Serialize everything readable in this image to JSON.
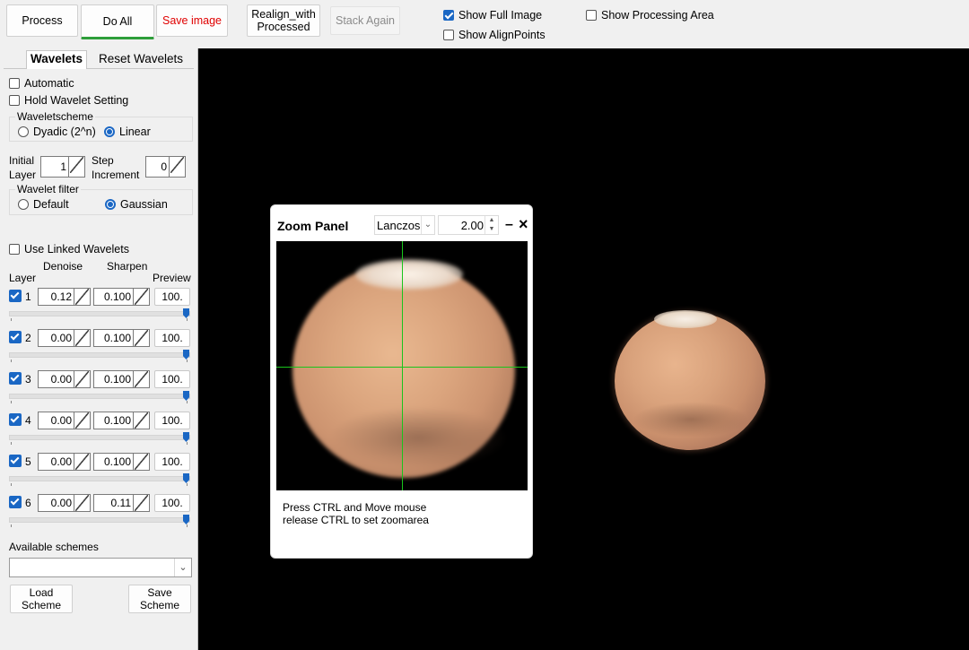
{
  "toolbar": {
    "process": "Process",
    "do_all": "Do All",
    "save_image": "Save image",
    "realign_line1": "Realign_with",
    "realign_line2": "Processed",
    "stack_again": "Stack Again",
    "show_full_image": "Show Full Image",
    "show_processing_area": "Show Processing Area",
    "show_alignpoints": "Show AlignPoints",
    "show_full_image_checked": true,
    "show_processing_area_checked": false,
    "show_alignpoints_checked": false
  },
  "sidebar": {
    "tab_wavelets": "Wavelets",
    "tab_reset": "Reset Wavelets",
    "automatic": "Automatic",
    "hold_setting": "Hold Wavelet Setting",
    "scheme_group": "Waveletscheme",
    "dyadic": "Dyadic (2^n)",
    "linear": "Linear",
    "initial_layer_l1": "Initial",
    "initial_layer_l2": "Layer",
    "initial_layer_value": "1",
    "step_l1": "Step",
    "step_l2": "Increment",
    "step_value": "0",
    "filter_group": "Wavelet filter",
    "filter_default": "Default",
    "filter_gaussian": "Gaussian",
    "use_linked": "Use Linked Wavelets",
    "col_layer": "Layer",
    "col_denoise": "Denoise",
    "col_sharpen": "Sharpen",
    "col_preview": "Preview",
    "layers": [
      {
        "num": "1",
        "denoise": "0.12",
        "sharpen": "0.100",
        "preview": "100."
      },
      {
        "num": "2",
        "denoise": "0.00",
        "sharpen": "0.100",
        "preview": "100."
      },
      {
        "num": "3",
        "denoise": "0.00",
        "sharpen": "0.100",
        "preview": "100."
      },
      {
        "num": "4",
        "denoise": "0.00",
        "sharpen": "0.100",
        "preview": "100."
      },
      {
        "num": "5",
        "denoise": "0.00",
        "sharpen": "0.100",
        "preview": "100."
      },
      {
        "num": "6",
        "denoise": "0.00",
        "sharpen": "0.11",
        "preview": "100."
      }
    ],
    "available_schemes": "Available schemes",
    "scheme_select_value": "",
    "load_l1": "Load",
    "load_l2": "Scheme",
    "save_l1": "Save",
    "save_l2": "Scheme"
  },
  "zoom": {
    "title": "Zoom Panel",
    "method": "Lanczos",
    "factor": "2.00",
    "minimize": "–",
    "close": "×",
    "hint_l1": "Press CTRL and Move mouse",
    "hint_l2": "release CTRL to set zoomarea"
  },
  "colors": {
    "accent": "#1a67c4",
    "active_tab_underline": "#2e9e3a",
    "save_text": "#e00000",
    "crosshair": "#19c41c"
  }
}
